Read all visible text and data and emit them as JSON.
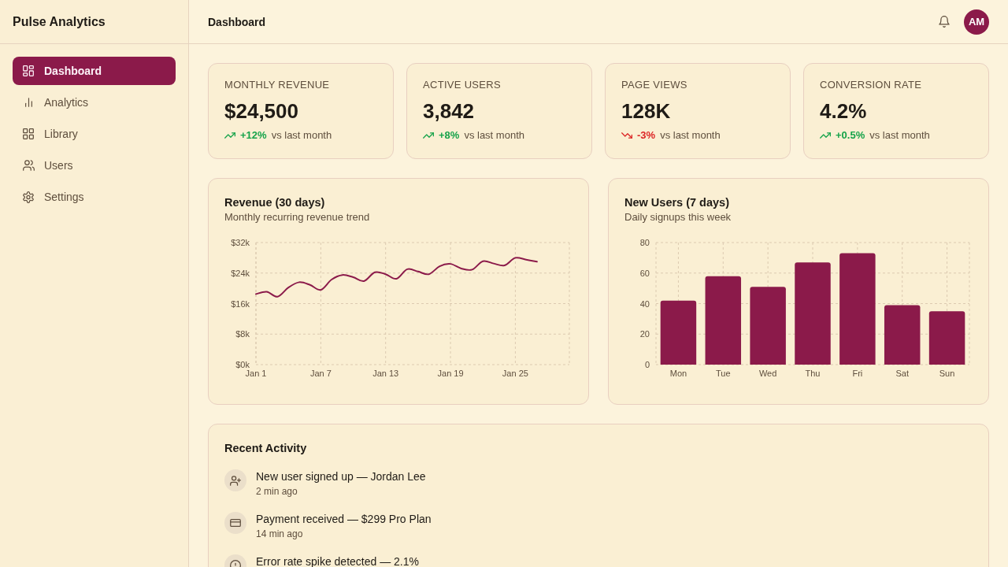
{
  "sidebar": {
    "title": "Pulse Analytics",
    "items": [
      {
        "label": "Dashboard",
        "selected": true
      },
      {
        "label": "Analytics",
        "selected": false
      },
      {
        "label": "Library",
        "selected": false
      },
      {
        "label": "Users",
        "selected": false
      },
      {
        "label": "Settings",
        "selected": false
      }
    ]
  },
  "header": {
    "title": "Dashboard",
    "avatar": "AM"
  },
  "kpis": [
    {
      "label": "MONTHLY REVENUE",
      "value": "$24,500",
      "kind": "up",
      "change": "+12%",
      "note": "vs last month"
    },
    {
      "label": "ACTIVE USERS",
      "value": "3,842",
      "kind": "up",
      "change": "+8%",
      "note": "vs last month"
    },
    {
      "label": "PAGE VIEWS",
      "value": "128K",
      "kind": "down",
      "change": "-3%",
      "note": "vs last month"
    },
    {
      "label": "CONVERSION RATE",
      "value": "4.2%",
      "kind": "up",
      "change": "+0.5%",
      "note": "vs last month"
    }
  ],
  "charts": [
    {
      "title": "Revenue (30 days)",
      "subtitle": "Monthly recurring revenue trend",
      "chart_data": {
        "type": "line",
        "categories": [
          "Jan 1",
          null,
          null,
          null,
          null,
          null,
          "Jan 7",
          null,
          null,
          null,
          null,
          null,
          "Jan 13",
          null,
          null,
          null,
          null,
          null,
          "Jan 19",
          null,
          null,
          null,
          null,
          null,
          "Jan 25",
          null,
          null,
          null,
          null,
          null
        ],
        "series": [
          {
            "color": "#8b1a4a",
            "values": [
              18500,
              19100,
              17800,
              20200,
              21600,
              20900,
              19600,
              22300,
              23500,
              22900,
              21900,
              24200,
              23700,
              22500,
              25000,
              24400,
              23700,
              25800,
              26400,
              25200,
              24900,
              27100,
              26500,
              26000,
              28000,
              27500,
              27000,
              null,
              null,
              null
            ]
          }
        ],
        "ylim": [
          0,
          32000
        ],
        "yticks": [
          {
            "value": 0,
            "label": "$0k"
          },
          {
            "value": 8000,
            "label": "$8k"
          },
          {
            "value": 16000,
            "label": "$16k"
          },
          {
            "value": 24000,
            "label": "$24k"
          },
          {
            "value": 32000,
            "label": "$32k"
          }
        ],
        "grid": true
      }
    },
    {
      "title": "New Users (7 days)",
      "subtitle": "Daily signups this week",
      "chart_data": {
        "type": "bar",
        "categories": [
          "Mon",
          "Tue",
          "Wed",
          "Thu",
          "Fri",
          "Sat",
          "Sun"
        ],
        "series": [
          {
            "color": "#8b1a4a",
            "values": [
              42,
              58,
              51,
              67,
              73,
              39,
              35
            ]
          }
        ],
        "ylim": [
          0,
          80
        ],
        "yticks": [
          0,
          20,
          40,
          60,
          80
        ],
        "grid": true
      }
    }
  ],
  "activity": {
    "title": "Recent Activity",
    "items": [
      {
        "text": "New user signed up — Jordan Lee",
        "time": "2 min ago"
      },
      {
        "text": "Payment received — $299 Pro Plan",
        "time": "14 min ago"
      },
      {
        "text": "Error rate spike detected — 2.1%"
      }
    ]
  }
}
